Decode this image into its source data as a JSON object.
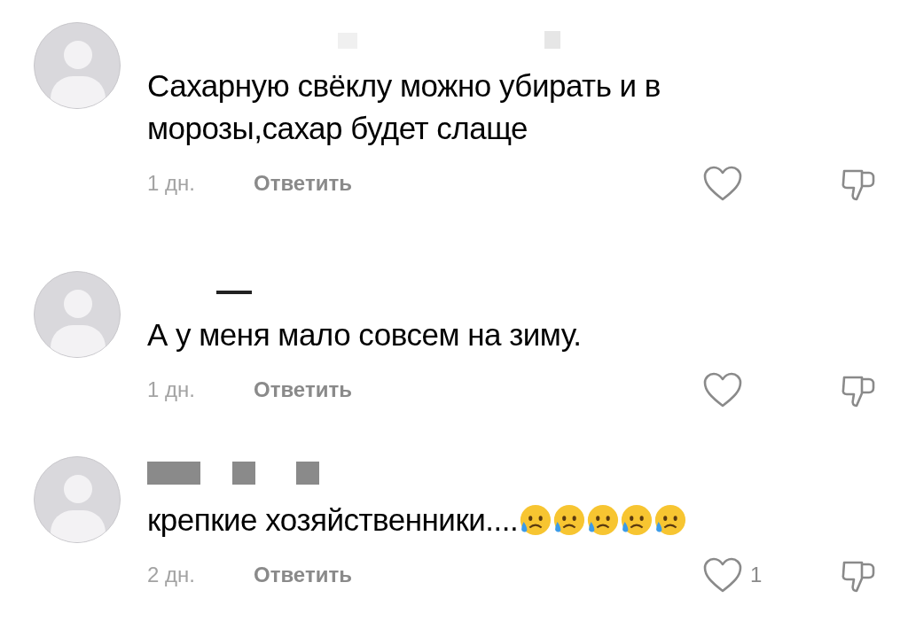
{
  "comments": [
    {
      "text": "Сахарную свёклу можно убирать и в морозы,сахар будет слаще",
      "time": "1 дн.",
      "reply": "Ответить",
      "liked": false,
      "disliked": false
    },
    {
      "text": "А у меня мало совсем на зиму.",
      "time": "1 дн.",
      "reply": "Ответить",
      "liked": false,
      "disliked": false
    },
    {
      "text": "крепкие хозяйственники....",
      "emoji": [
        {
          "kind": "sad"
        },
        {
          "kind": "sad"
        },
        {
          "kind": "sad"
        },
        {
          "kind": "sad"
        },
        {
          "kind": "sad"
        }
      ],
      "time": "2 дн.",
      "reply": "Ответить",
      "liked": false,
      "disliked": false,
      "likes": "1"
    }
  ]
}
